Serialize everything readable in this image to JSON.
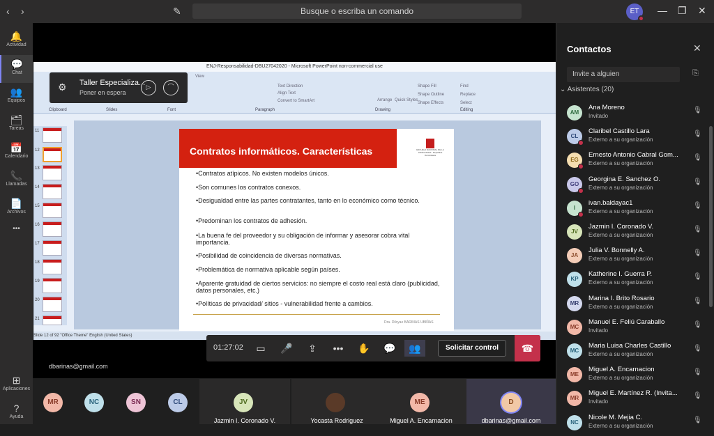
{
  "titlebar": {
    "search_placeholder": "Busque o escriba un comando",
    "user_initials": "ET",
    "back": "‹",
    "forward": "›",
    "compose": "✎",
    "minimize": "—",
    "maximize": "❐",
    "close": "✕"
  },
  "rail": [
    {
      "label": "Actividad",
      "icon": "🔔"
    },
    {
      "label": "Chat",
      "icon": "💬"
    },
    {
      "label": "Equipos",
      "icon": "👥"
    },
    {
      "label": "Tareas",
      "icon": "🗂"
    },
    {
      "label": "Calendario",
      "icon": "📅"
    },
    {
      "label": "Llamadas",
      "icon": "📞"
    },
    {
      "label": "Archivos",
      "icon": "📄"
    },
    {
      "label": "Aplicaciones",
      "icon": "⊞"
    },
    {
      "label": "Ayuda",
      "icon": "?"
    }
  ],
  "rail_more": "•••",
  "ppt": {
    "window_title": "ENJ-Responsabilidad-DBU27042020 - Microsoft PowerPoint non-commercial use",
    "view_tab": "View",
    "groups": [
      "Clipboard",
      "Slides",
      "Font",
      "Paragraph",
      "Drawing",
      "Editing"
    ],
    "ribbon_items": [
      "Text Direction",
      "Align Text",
      "Convert to SmartArt",
      "Arrange",
      "Quick Styles",
      "Shape Fill",
      "Shape Outline",
      "Shape Effects",
      "Find",
      "Replace",
      "Select"
    ],
    "thumb_numbers": [
      "11",
      "12",
      "13",
      "14",
      "15",
      "16",
      "17",
      "18",
      "19",
      "20",
      "21"
    ],
    "status": "Slide 12 of 92    \"Office Theme\"    English (United States)"
  },
  "slide": {
    "title": "Contratos informáticos. Características",
    "logo_text": "ESCUELA NACIONAL DE LA JUDICATURA · República Dominicana",
    "bullets": [
      "•Contratos atípicos. No existen modelos únicos.",
      "•Son comunes los contratos conexos.",
      "•Desigualdad entre las partes contratantes, tanto en lo económico como técnico.",
      "•Predominan los contratos de adhesión.",
      "•La buena fe del proveedor y su obligación de informar y asesorar cobra vital importancia.",
      "•Posibilidad de coincidencia de diversas normativas.",
      "•Problemática de normativa aplicable según países.",
      "•Aparente gratuidad de ciertos servicios: no siempre el costo real está claro (publicidad, datos personales, etc.)",
      "•Políticas de privacidad/ sitios - vulnerabilidad frente a cambios."
    ],
    "signature": "Dra. Dilcyae BARINAS UBIÑAS"
  },
  "share_banner": {
    "title": "Taller Especializa...",
    "subtitle": "Poner en espera",
    "icon": "⚙",
    "resume": "▷",
    "hangup": "⌒"
  },
  "callbar": {
    "timer": "01:27:02",
    "request_control": "Solicitar control",
    "video_icon": "▭",
    "mic_icon": "🎤",
    "share_icon": "⇪",
    "more_icon": "•••",
    "hand_icon": "✋",
    "chat_icon": "💬",
    "participants_icon": "👥",
    "hangup_icon": "☎"
  },
  "presenter_email": "dbarinas@gmail.com",
  "gallery": {
    "small": [
      {
        "initials": "MR",
        "color": "#f2b8a8"
      },
      {
        "initials": "NC",
        "color": "#bfe0ea"
      },
      {
        "initials": "SN",
        "color": "#eec4d6"
      },
      {
        "initials": "CL",
        "color": "#bccbe8"
      }
    ],
    "tiles": [
      {
        "initials": "JV",
        "name": "Jazmin I. Coronado V.",
        "color": "#d7e5b9"
      },
      {
        "initials": "",
        "name": "Yocasta Rodriguez",
        "color": "#5a3a28"
      },
      {
        "initials": "ME",
        "name": "Miguel A. Encarnacion",
        "color": "#f2b8a8"
      },
      {
        "initials": "D",
        "name": "dbarinas@gmail.com",
        "color": "#f1c8a6"
      }
    ]
  },
  "panel": {
    "title": "Contactos",
    "invite_placeholder": "Invite a alguien",
    "section": "Asistentes (20)",
    "people": [
      {
        "initials": "AM",
        "name": "Ana Moreno",
        "sub": "Invitado",
        "color": "#c6e4cf",
        "dot": false
      },
      {
        "initials": "CL",
        "name": "Claribel Castillo Lara",
        "sub": "Externo a su organización",
        "color": "#bccbe8",
        "dot": true
      },
      {
        "initials": "EG",
        "name": "Ernesto Antonio Cabral Gom...",
        "sub": "Externo a su organización",
        "color": "#f5deb0",
        "dot": true
      },
      {
        "initials": "GO",
        "name": "Georgina E. Sanchez O.",
        "sub": "Externo a su organización",
        "color": "#c9c8ea",
        "dot": true
      },
      {
        "initials": "I",
        "name": "ivan.baldayac1",
        "sub": "Externo a su organización",
        "color": "#c6e4cf",
        "dot": true
      },
      {
        "initials": "JV",
        "name": "Jazmin I. Coronado V.",
        "sub": "Externo a su organización",
        "color": "#d7e5b9",
        "dot": false
      },
      {
        "initials": "JA",
        "name": "Julia V. Bonnelly A.",
        "sub": "Externo a su organización",
        "color": "#f4cdb8",
        "dot": false
      },
      {
        "initials": "KP",
        "name": "Katherine I. Guerra P.",
        "sub": "Externo a su organización",
        "color": "#bfe0ea",
        "dot": false
      },
      {
        "initials": "MR",
        "name": "Marina I. Brito Rosario",
        "sub": "Externo a su organización",
        "color": "#d4d8ee",
        "dot": false
      },
      {
        "initials": "MC",
        "name": "Manuel E. Feliú Caraballo",
        "sub": "Invitado",
        "color": "#f2b8a8",
        "dot": false
      },
      {
        "initials": "MC",
        "name": "Maria Luisa Charles Castillo",
        "sub": "Externo a su organización",
        "color": "#bfe0ea",
        "dot": false
      },
      {
        "initials": "ME",
        "name": "Miguel A. Encarnacion",
        "sub": "Externo a su organización",
        "color": "#f2b8a8",
        "dot": false
      },
      {
        "initials": "MR",
        "name": "Miguel E. Martínez R. (Invita...",
        "sub": "Invitado",
        "color": "#f2b8a8",
        "dot": false
      },
      {
        "initials": "NC",
        "name": "Nicole M. Mejia C.",
        "sub": "Externo a su organización",
        "color": "#bfe0ea",
        "dot": false
      }
    ]
  }
}
